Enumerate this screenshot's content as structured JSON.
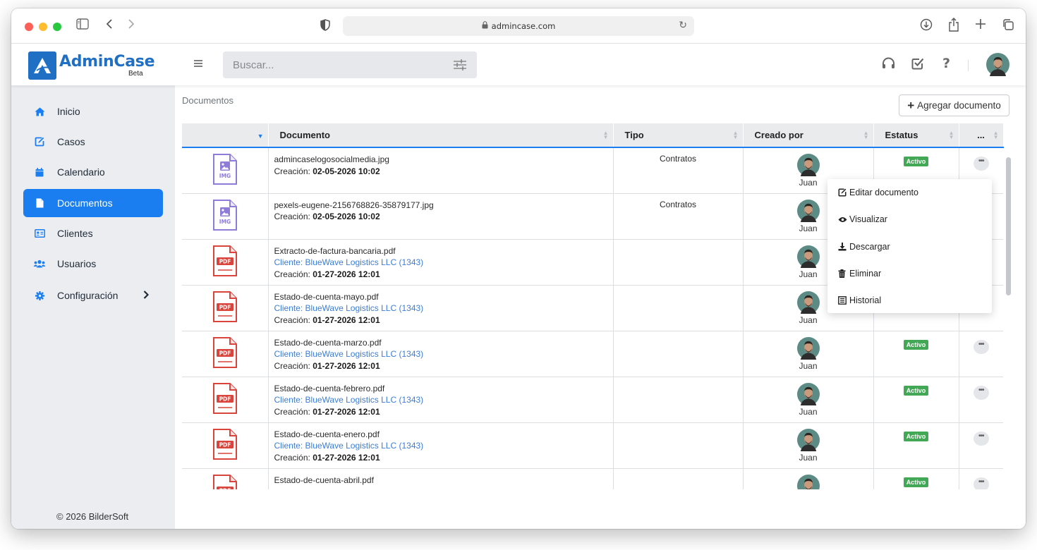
{
  "browser": {
    "url": "admincase.com"
  },
  "header": {
    "logo_name": "AdminCase",
    "logo_tag": "Beta",
    "search_placeholder": "Buscar..."
  },
  "sidebar": {
    "items": [
      {
        "label": "Inicio",
        "icon": "home-icon"
      },
      {
        "label": "Casos",
        "icon": "edit-icon"
      },
      {
        "label": "Calendario",
        "icon": "calendar-icon"
      },
      {
        "label": "Documentos",
        "icon": "document-icon",
        "active": true
      },
      {
        "label": "Clientes",
        "icon": "id-card-icon"
      },
      {
        "label": "Usuarios",
        "icon": "users-icon"
      },
      {
        "label": "Configuración",
        "icon": "gear-icon"
      }
    ],
    "footer": "© 2026 BilderSoft"
  },
  "main": {
    "breadcrumb": "Documentos",
    "add_button": "Agregar documento",
    "columns": [
      "Documento",
      "Tipo",
      "Creado por",
      "Estatus",
      "..."
    ],
    "rows": [
      {
        "file_type": "IMG",
        "name": "admincaselogosocialmedia.jpg",
        "client": "",
        "created_label": "Creación:",
        "created": "02-05-2026 10:02",
        "tipo": "Contratos",
        "by": "Juan",
        "status": "Activo"
      },
      {
        "file_type": "IMG",
        "name": "pexels-eugene-2156768826-35879177.jpg",
        "client": "",
        "created_label": "Creación:",
        "created": "02-05-2026 10:02",
        "tipo": "Contratos",
        "by": "Juan",
        "status": ""
      },
      {
        "file_type": "PDF",
        "name": "Extracto-de-factura-bancaria.pdf",
        "client": "Cliente: BlueWave Logistics LLC (1343)",
        "created_label": "Creación:",
        "created": "01-27-2026 12:01",
        "tipo": "",
        "by": "Juan",
        "status": ""
      },
      {
        "file_type": "PDF",
        "name": "Estado-de-cuenta-mayo.pdf",
        "client": "Cliente: BlueWave Logistics LLC (1343)",
        "created_label": "Creación:",
        "created": "01-27-2026 12:01",
        "tipo": "",
        "by": "Juan",
        "status": ""
      },
      {
        "file_type": "PDF",
        "name": "Estado-de-cuenta-marzo.pdf",
        "client": "Cliente: BlueWave Logistics LLC (1343)",
        "created_label": "Creación:",
        "created": "01-27-2026 12:01",
        "tipo": "",
        "by": "Juan",
        "status": "Activo"
      },
      {
        "file_type": "PDF",
        "name": "Estado-de-cuenta-febrero.pdf",
        "client": "Cliente: BlueWave Logistics LLC (1343)",
        "created_label": "Creación:",
        "created": "01-27-2026 12:01",
        "tipo": "",
        "by": "Juan",
        "status": "Activo"
      },
      {
        "file_type": "PDF",
        "name": "Estado-de-cuenta-enero.pdf",
        "client": "Cliente: BlueWave Logistics LLC (1343)",
        "created_label": "Creación:",
        "created": "01-27-2026 12:01",
        "tipo": "",
        "by": "Juan",
        "status": "Activo"
      },
      {
        "file_type": "PDF",
        "name": "Estado-de-cuenta-abril.pdf",
        "client": "",
        "created_label": "",
        "created": "",
        "tipo": "",
        "by": "",
        "status": "Activo"
      }
    ]
  },
  "context_menu": {
    "items": [
      {
        "label": "Editar documento",
        "icon": "edit-icon"
      },
      {
        "label": "Visualizar",
        "icon": "eye-icon"
      },
      {
        "label": "Descargar",
        "icon": "download-icon"
      },
      {
        "label": "Eliminar",
        "icon": "trash-icon"
      },
      {
        "label": "Historial",
        "icon": "history-icon"
      }
    ]
  },
  "colors": {
    "accent": "#1a7ef0",
    "brand": "#1f6fc5",
    "status_active": "#43a855",
    "pdf_red": "#d9443c",
    "img_purple": "#8e7cd8"
  }
}
